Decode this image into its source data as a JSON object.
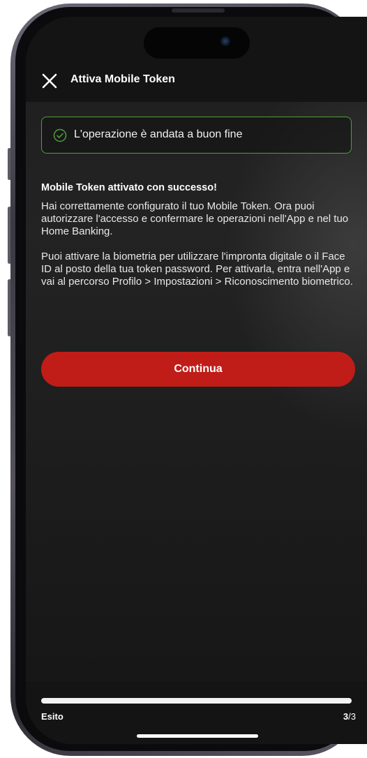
{
  "header": {
    "title": "Attiva Mobile Token"
  },
  "alert": {
    "message": "L'operazione è andata a buon fine",
    "status_color": "#4f9f3a"
  },
  "content": {
    "title": "Mobile Token attivato con successo!",
    "paragraph_1": "Hai correttamente configurato il tuo Mobile Token. Ora puoi autorizzare l'accesso e confermare le operazioni nell'App e nel tuo Home Banking.",
    "paragraph_2": "Puoi attivare la biometria per utilizzare l'impronta digitale o il Face ID al posto della tua token password. Per attivarla, entra nell'App e vai al percorso Profilo > Impostazioni > Riconoscimento biometrico."
  },
  "actions": {
    "continue_label": "Continua",
    "accent_color": "#c01d18"
  },
  "progress": {
    "label": "Esito",
    "current": "3",
    "total": "/3",
    "fraction": 1.0
  },
  "icons": {
    "close": "close-icon",
    "success": "check-circle-icon"
  }
}
